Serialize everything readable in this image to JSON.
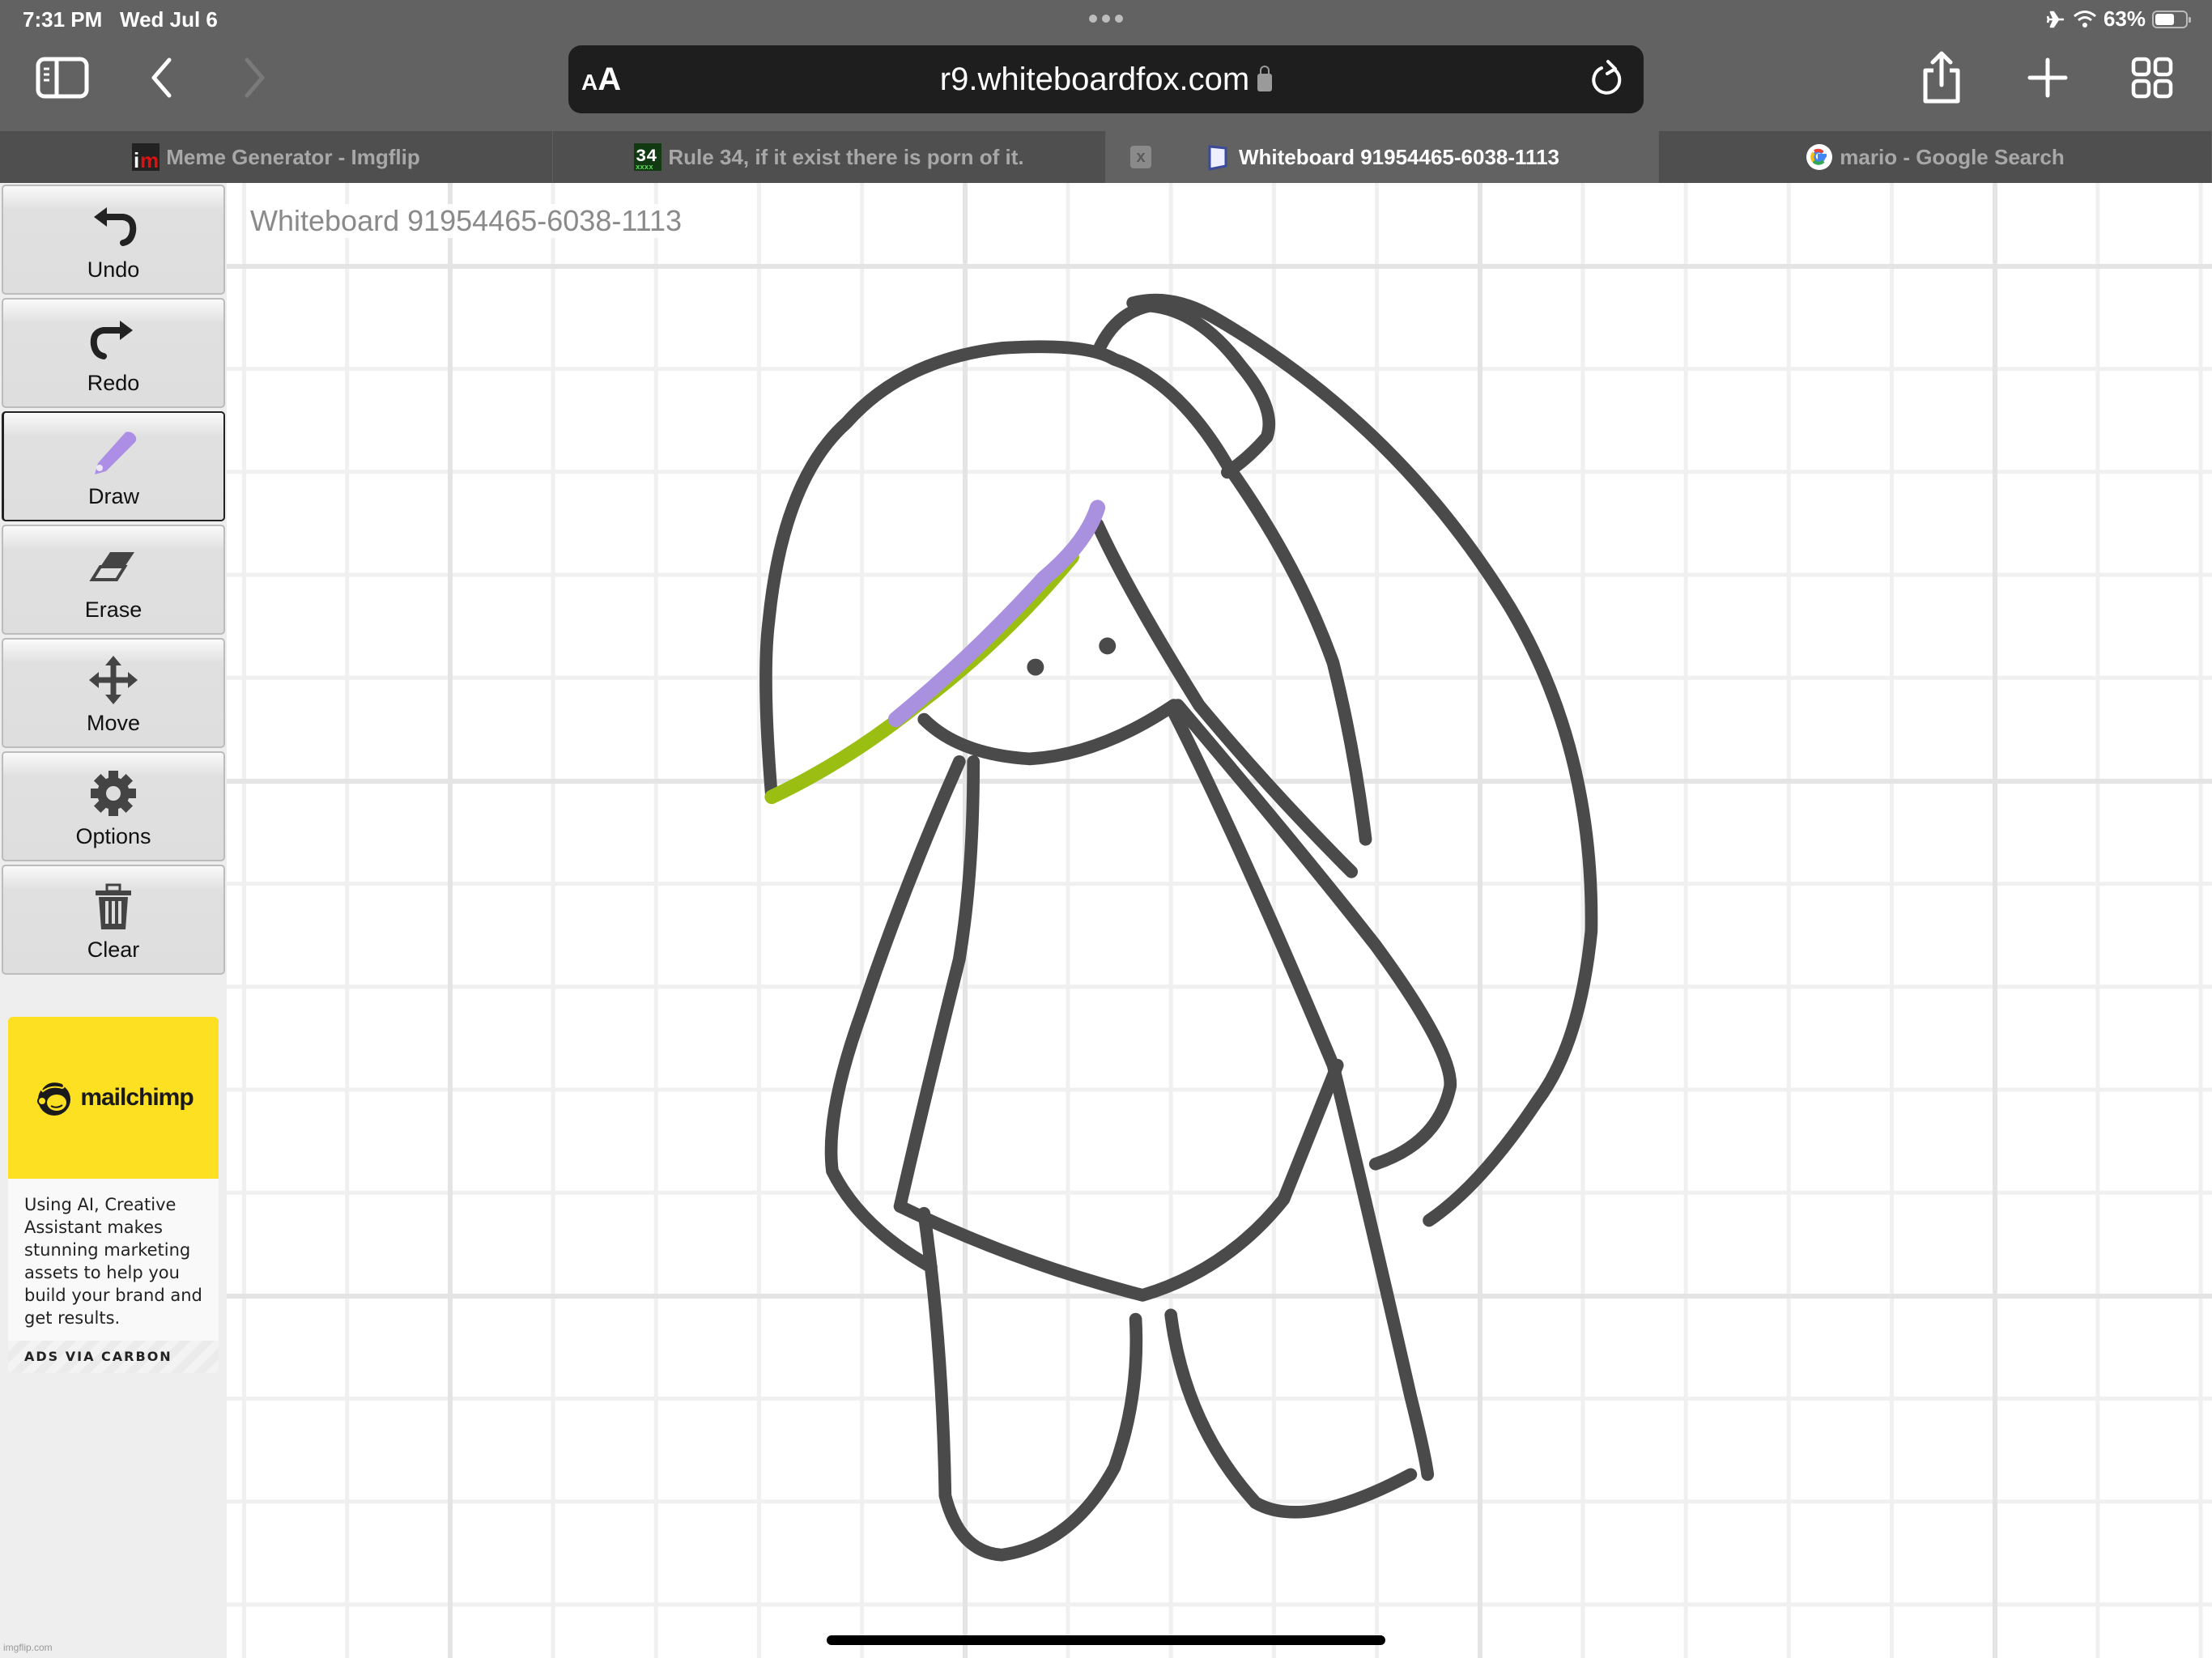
{
  "status_bar": {
    "time": "7:31 PM",
    "date": "Wed Jul 6",
    "battery_percent_label": "63%",
    "battery_level": 0.63,
    "icons": [
      "airplane-mode-icon",
      "wifi-icon",
      "battery-icon"
    ]
  },
  "browser": {
    "address_bar": {
      "text_size_label": "AA",
      "url": "r9.whiteboardfox.com",
      "secure": true
    },
    "toolbar_icons": [
      "sidebar-icon",
      "back-icon",
      "forward-icon",
      "share-icon",
      "new-tab-icon",
      "tab-overview-icon"
    ],
    "tabs": [
      {
        "title": "Meme Generator - Imgflip",
        "favicon": "imgflip-favicon",
        "active": false
      },
      {
        "title": "Rule 34, if it exist there is porn of it.",
        "favicon": "rule34-favicon",
        "active": false
      },
      {
        "title": "Whiteboard 91954465-6038-1113",
        "favicon": "whiteboard-favicon",
        "active": true,
        "close_label": "x"
      },
      {
        "title": "mario - Google Search",
        "favicon": "google-favicon",
        "active": false
      }
    ]
  },
  "whiteboard": {
    "title": "Whiteboard 91954465-6038-1113",
    "tools": [
      {
        "label": "Undo",
        "icon": "undo-icon",
        "active": false
      },
      {
        "label": "Redo",
        "icon": "redo-icon",
        "active": false
      },
      {
        "label": "Draw",
        "icon": "pencil-icon",
        "active": true
      },
      {
        "label": "Erase",
        "icon": "eraser-icon",
        "active": false
      },
      {
        "label": "Move",
        "icon": "move-icon",
        "active": false
      },
      {
        "label": "Options",
        "icon": "gear-icon",
        "active": false
      },
      {
        "label": "Clear",
        "icon": "trash-icon",
        "active": false
      }
    ],
    "pen_colors": {
      "ink": "#4a4a4a",
      "purple": "#a991e0",
      "green": "#9abe12"
    },
    "ad": {
      "brand": "mailchimp",
      "text": "Using AI, Creative Assistant makes stunning marketing assets to help you build your brand and get results.",
      "via": "ADS VIA CARBON"
    },
    "watermark": "imgflip.com"
  }
}
